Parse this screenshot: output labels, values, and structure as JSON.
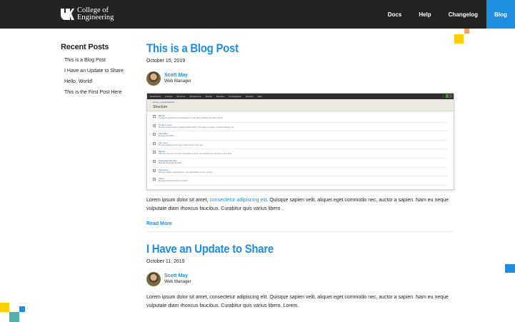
{
  "header": {
    "logo_line1": "College of",
    "logo_line2": "Engineering",
    "nav": [
      {
        "label": "Docs"
      },
      {
        "label": "Help"
      },
      {
        "label": "Changelog"
      },
      {
        "label": "Blog",
        "active": true
      }
    ]
  },
  "colors": {
    "accent": "#1e8fe0",
    "header_bg": "#232323",
    "yellow": "#ffd100",
    "teal": "#4fb3a9",
    "orange": "#f7a06a"
  },
  "sidebar": {
    "title": "Recent Posts",
    "items": [
      "This is a Blog Post",
      "I Have an Update to Share",
      "Hello, World!",
      "This is the First Post Here"
    ]
  },
  "posts": [
    {
      "title": "This is a Blog Post",
      "date": "October 15, 2019",
      "author": "Scott May",
      "role": "Web Manager",
      "excerpt_before": "Lorem ipsum dolor sit amet, ",
      "excerpt_link": "consectetur adipiscing elit",
      "excerpt_after": ". Quisque sapien velit, aliquet eget commodo nec, auctor a sapien. Nam eu neque vulputate diam rhoncus faucibus. Curabitur quis varius libero .",
      "read_more": "Read More"
    },
    {
      "title": "I Have an Update to Share",
      "date": "October 11, 2019",
      "author": "Scott May",
      "role": "Web Manager",
      "excerpt": "Lorem ipsum dolor sit amet, consectetur adipiscing elit. Quisque sapien velit, aliquet eget commodo nec, auctor a sapien. Nam eu neque vulputate diam rhoncus faucibus. Curabitur quis varius libero. Lorem."
    }
  ],
  "screenshot": {
    "topbar": [
      "Dashboard",
      "Content",
      "Structure",
      "Appearance",
      "People",
      "Modules",
      "Configuration",
      "Reports",
      "Help"
    ],
    "crumb": "Home » Administration",
    "title": "Structure",
    "rows": [
      {
        "t": "Blocks",
        "d": "Configure what block content appears in your site's sidebars and other regions."
      },
      {
        "t": "Content types",
        "d": "Manage content types, including default status, front page promotion, comment settings, etc."
      },
      {
        "t": "Flexslider",
        "d": "Manage FlexSlider"
      },
      {
        "t": "File types",
        "d": "Manage settings for the type of files used on your site."
      },
      {
        "t": "Menus",
        "d": "Add new menus to your site, edit existing menus, and rename and reorganize menu links."
      },
      {
        "t": "Paragraph Bundles",
        "d": "Manage Paragraph Bundles"
      },
      {
        "t": "Taxonomy",
        "d": "Manage tagging, categorization, and classification of your content."
      },
      {
        "t": "Views",
        "d": "Manage customized lists of content."
      }
    ]
  }
}
